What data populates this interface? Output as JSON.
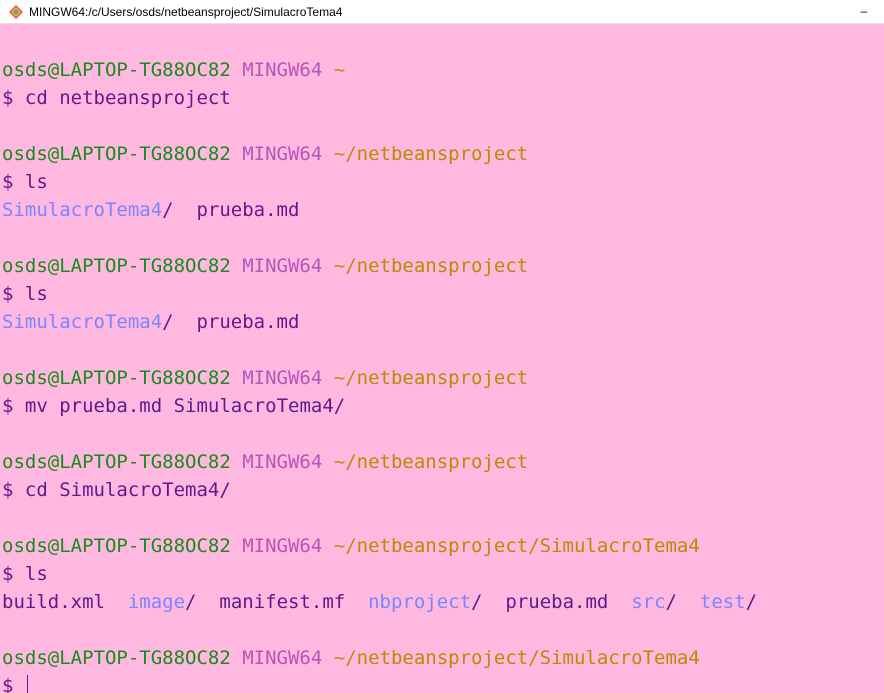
{
  "window": {
    "title": "MINGW64:/c/Users/osds/netbeansproject/SimulacroTema4",
    "minimize_glyph": "–"
  },
  "prompt": {
    "user_host": "osds@LAPTOP-TG88OC82",
    "system": "MINGW64",
    "dollar": "$"
  },
  "colors": {
    "background": "#ffb8e0",
    "user_host": "#1a8a1a",
    "system": "#b854b8",
    "path": "#b38f00",
    "directory": "#7a86ff",
    "text": "#5c1a8c"
  },
  "blocks": [
    {
      "path": "~",
      "command": "cd netbeansproject",
      "output": []
    },
    {
      "path": "~/netbeansproject",
      "command": "ls",
      "output": [
        {
          "text": "SimulacroTema4",
          "type": "dir"
        },
        {
          "text": "/  ",
          "type": "plain"
        },
        {
          "text": "prueba.md",
          "type": "plain"
        }
      ]
    },
    {
      "path": "~/netbeansproject",
      "command": "ls",
      "output": [
        {
          "text": "SimulacroTema4",
          "type": "dir"
        },
        {
          "text": "/  ",
          "type": "plain"
        },
        {
          "text": "prueba.md",
          "type": "plain"
        }
      ]
    },
    {
      "path": "~/netbeansproject",
      "command": "mv prueba.md SimulacroTema4/",
      "output": []
    },
    {
      "path": "~/netbeansproject",
      "command": "cd SimulacroTema4/",
      "output": []
    },
    {
      "path": "~/netbeansproject/SimulacroTema4",
      "command": "ls",
      "output": [
        {
          "text": "build.xml  ",
          "type": "plain"
        },
        {
          "text": "image",
          "type": "dir"
        },
        {
          "text": "/  ",
          "type": "plain"
        },
        {
          "text": "manifest.mf  ",
          "type": "plain"
        },
        {
          "text": "nbproject",
          "type": "dir"
        },
        {
          "text": "/  ",
          "type": "plain"
        },
        {
          "text": "prueba.md  ",
          "type": "plain"
        },
        {
          "text": "src",
          "type": "dir"
        },
        {
          "text": "/  ",
          "type": "plain"
        },
        {
          "text": "test",
          "type": "dir"
        },
        {
          "text": "/",
          "type": "plain"
        }
      ]
    }
  ],
  "final_prompt": {
    "path": "~/netbeansproject/SimulacroTema4"
  }
}
